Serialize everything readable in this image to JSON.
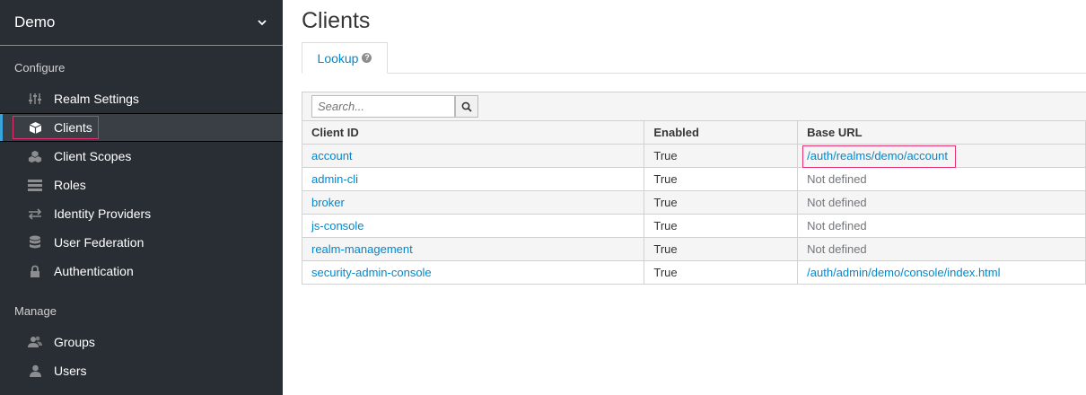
{
  "sidebar": {
    "realm": "Demo",
    "configure_label": "Configure",
    "manage_label": "Manage",
    "configure_items": [
      {
        "label": "Realm Settings",
        "icon": "sliders-icon"
      },
      {
        "label": "Clients",
        "icon": "cube-icon",
        "active": true
      },
      {
        "label": "Client Scopes",
        "icon": "cubes-icon"
      },
      {
        "label": "Roles",
        "icon": "list-icon"
      },
      {
        "label": "Identity Providers",
        "icon": "exchange-icon"
      },
      {
        "label": "User Federation",
        "icon": "database-icon"
      },
      {
        "label": "Authentication",
        "icon": "lock-icon"
      }
    ],
    "manage_items": [
      {
        "label": "Groups",
        "icon": "users-icon"
      },
      {
        "label": "Users",
        "icon": "user-icon"
      }
    ]
  },
  "main": {
    "title": "Clients",
    "tab_label": "Lookup",
    "search_placeholder": "Search...",
    "columns": [
      "Client ID",
      "Enabled",
      "Base URL"
    ],
    "rows": [
      {
        "client_id": "account",
        "enabled": "True",
        "base_url": "/auth/realms/demo/account",
        "defined": true
      },
      {
        "client_id": "admin-cli",
        "enabled": "True",
        "base_url": "Not defined",
        "defined": false
      },
      {
        "client_id": "broker",
        "enabled": "True",
        "base_url": "Not defined",
        "defined": false
      },
      {
        "client_id": "js-console",
        "enabled": "True",
        "base_url": "Not defined",
        "defined": false
      },
      {
        "client_id": "realm-management",
        "enabled": "True",
        "base_url": "Not defined",
        "defined": false
      },
      {
        "client_id": "security-admin-console",
        "enabled": "True",
        "base_url": "/auth/admin/demo/console/index.html",
        "defined": true
      }
    ]
  },
  "colors": {
    "sidebar_bg": "#292e34",
    "active_bar": "#39a5dc",
    "link": "#0088ce",
    "highlight": "#e5306e"
  }
}
